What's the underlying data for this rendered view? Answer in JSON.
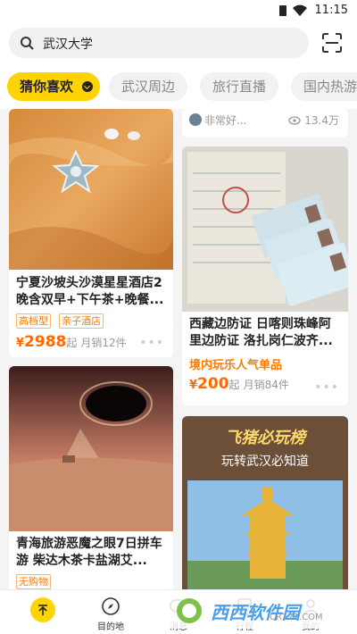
{
  "status": {
    "time": "11:15"
  },
  "search": {
    "query": "武汉大学"
  },
  "tabs": [
    {
      "label": "猜你喜欢",
      "active": true
    },
    {
      "label": "武汉周边"
    },
    {
      "label": "旅行直播"
    },
    {
      "label": "国内热游"
    }
  ],
  "feed": {
    "left": [
      {
        "title": "宁夏沙坡头沙漠星星酒店2晚含双早+下午茶+晚餐...",
        "tags": [
          "高档型",
          "亲子酒店"
        ],
        "currency": "¥",
        "price": "2988",
        "unit": "起",
        "sales": "月销12件",
        "image": "desert-star-hotel"
      },
      {
        "title": "青海旅游恶魔之眼7日拼车游 柴达木茶卡盐湖艾...",
        "tags": [
          "无购物"
        ],
        "image": "devils-eye-desert"
      }
    ],
    "right": [
      {
        "author": "非常好...",
        "views": "13.4万"
      },
      {
        "title": "西藏边防证 日喀则珠峰阿里边防证 洛扎岗仁波齐...",
        "promo": "境内玩乐人气单品",
        "currency": "¥",
        "price": "200",
        "unit": "起",
        "sales": "月销84件",
        "image": "border-permit-documents"
      },
      {
        "banner_title": "飞猪必玩榜",
        "banner_subtitle": "玩转武汉必知道",
        "image": "yellow-crane-tower"
      }
    ]
  },
  "bottom_nav": [
    {
      "label": "",
      "icon": "back-to-top-icon"
    },
    {
      "label": "目的地",
      "icon": "compass-icon"
    },
    {
      "label": "消息",
      "icon": "message-icon"
    },
    {
      "label": "行程",
      "icon": "itinerary-icon"
    },
    {
      "label": "我的",
      "icon": "profile-icon"
    }
  ],
  "watermark": {
    "text": "西西软件园",
    "sub": "CR173.COM"
  },
  "colors": {
    "accent": "#ffd400",
    "price": "#ff6a00",
    "tag": "#ff7a00"
  }
}
